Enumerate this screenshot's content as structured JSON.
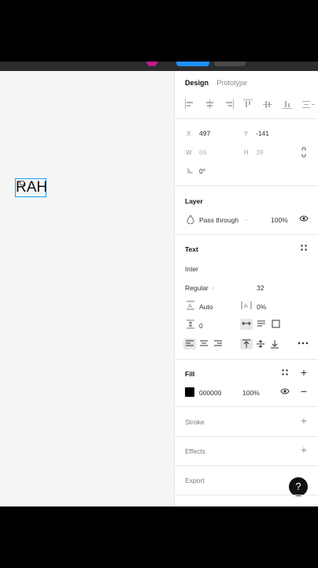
{
  "tabs": {
    "design": "Design",
    "prototype": "Prototype"
  },
  "position": {
    "x_label": "X",
    "x_value": "497",
    "y_label": "Y",
    "y_value": "-141"
  },
  "size": {
    "w_label": "W",
    "w_value": "66",
    "h_label": "H",
    "h_value": "39"
  },
  "rotation": {
    "value": "0°"
  },
  "layer": {
    "title": "Layer",
    "blend_mode": "Pass through",
    "opacity": "100%"
  },
  "text": {
    "title": "Text",
    "font_family": "Inter",
    "font_weight": "Regular",
    "font_size": "32",
    "line_height": "Auto",
    "letter_spacing": "0%",
    "paragraph_spacing": "0"
  },
  "fill": {
    "title": "Fill",
    "hex": "000000",
    "opacity": "100%",
    "color": "#000000"
  },
  "stroke": {
    "title": "Stroke"
  },
  "effects": {
    "title": "Effects"
  },
  "export": {
    "title": "Export"
  },
  "canvas": {
    "text_content": "RAH"
  },
  "help": {
    "label": "?"
  },
  "colors": {
    "selection": "#18a0fb",
    "toolbar_accent": "#1e90ff",
    "toolbar_magenta": "#c41a8f"
  }
}
